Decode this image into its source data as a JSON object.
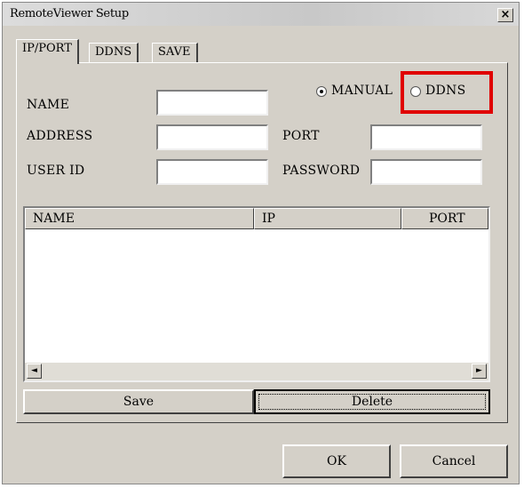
{
  "window": {
    "title": "RemoteViewer Setup",
    "close_glyph": "×"
  },
  "tabs": [
    {
      "label": "IP/PORT",
      "active": true
    },
    {
      "label": "DDNS",
      "active": false
    },
    {
      "label": "SAVE",
      "active": false
    }
  ],
  "form": {
    "name_label": "NAME",
    "address_label": "ADDRESS",
    "userid_label": "USER ID",
    "port_label": "PORT",
    "password_label": "PASSWORD",
    "name_value": "",
    "address_value": "",
    "userid_value": "",
    "port_value": "",
    "password_value": ""
  },
  "mode": {
    "manual_label": "MANUAL",
    "ddns_label": "DDNS",
    "selected": "MANUAL"
  },
  "annotation": {
    "color": "#e00000"
  },
  "list": {
    "columns": [
      "NAME",
      "IP",
      "PORT"
    ],
    "rows": []
  },
  "actions": {
    "save_label": "Save",
    "delete_label": "Delete"
  },
  "dialog": {
    "ok_label": "OK",
    "cancel_label": "Cancel"
  },
  "icons": {
    "scroll_left": "◄",
    "scroll_right": "►"
  }
}
